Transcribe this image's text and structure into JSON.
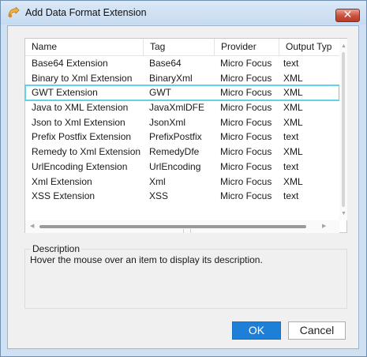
{
  "window": {
    "title": "Add Data Format Extension",
    "close_glyph": "✕"
  },
  "table": {
    "columns": [
      "Name",
      "Tag",
      "Provider",
      "Output Typ"
    ],
    "rows": [
      {
        "name": "Base64 Extension",
        "tag": "Base64",
        "provider": "Micro Focus",
        "output": "text"
      },
      {
        "name": "Binary to Xml Extension",
        "tag": "BinaryXml",
        "provider": "Micro Focus",
        "output": "XML"
      },
      {
        "name": "GWT Extension",
        "tag": "GWT",
        "provider": "Micro Focus",
        "output": "XML"
      },
      {
        "name": "Java to XML Extension",
        "tag": "JavaXmlDFE",
        "provider": "Micro Focus",
        "output": "XML"
      },
      {
        "name": "Json to Xml Extension",
        "tag": "JsonXml",
        "provider": "Micro Focus",
        "output": "XML"
      },
      {
        "name": "Prefix Postfix Extension",
        "tag": "PrefixPostfix",
        "provider": "Micro Focus",
        "output": "text"
      },
      {
        "name": "Remedy to Xml Extension",
        "tag": "RemedyDfe",
        "provider": "Micro Focus",
        "output": "XML"
      },
      {
        "name": "UrlEncoding Extension",
        "tag": "UrlEncoding",
        "provider": "Micro Focus",
        "output": "text"
      },
      {
        "name": "Xml Extension",
        "tag": "Xml",
        "provider": "Micro Focus",
        "output": "XML"
      },
      {
        "name": "XSS Extension",
        "tag": "XSS",
        "provider": "Micro Focus",
        "output": "text"
      }
    ],
    "selected_index": 2
  },
  "description": {
    "label": "Description",
    "text": "Hover the mouse over an item to display its description."
  },
  "buttons": {
    "ok": "OK",
    "cancel": "Cancel"
  },
  "colors": {
    "selection_outline": "#62d2e6",
    "ok_button": "#1e7fd9"
  }
}
